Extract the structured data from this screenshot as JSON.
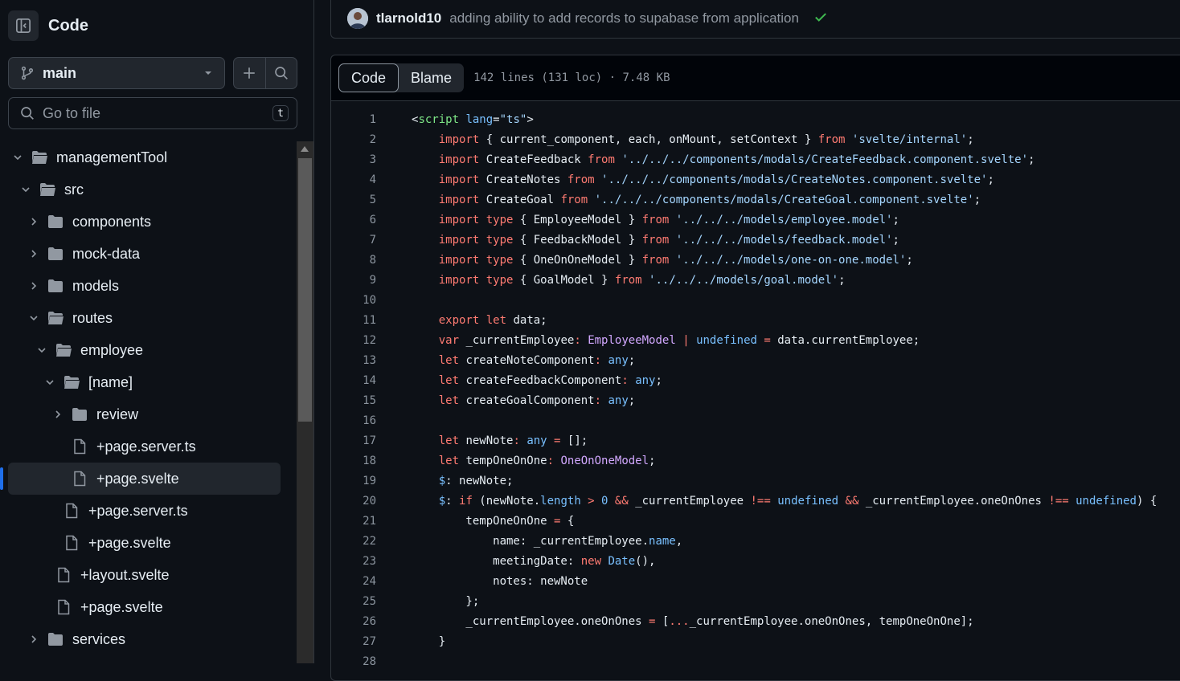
{
  "sidebar": {
    "title": "Code",
    "branch": "main",
    "search_placeholder": "Go to file",
    "search_shortcut": "t",
    "tree": [
      {
        "label": "managementTool",
        "type": "folder",
        "expanded": true,
        "depth": 0
      },
      {
        "label": "src",
        "type": "folder",
        "expanded": true,
        "depth": 1
      },
      {
        "label": "components",
        "type": "folder",
        "expanded": false,
        "depth": 2
      },
      {
        "label": "mock-data",
        "type": "folder",
        "expanded": false,
        "depth": 2
      },
      {
        "label": "models",
        "type": "folder",
        "expanded": false,
        "depth": 2
      },
      {
        "label": "routes",
        "type": "folder",
        "expanded": true,
        "depth": 2
      },
      {
        "label": "employee",
        "type": "folder",
        "expanded": true,
        "depth": 3
      },
      {
        "label": "[name]",
        "type": "folder",
        "expanded": true,
        "depth": 4
      },
      {
        "label": "review",
        "type": "folder",
        "expanded": false,
        "depth": 5
      },
      {
        "label": "+page.server.ts",
        "type": "file",
        "depth": 5
      },
      {
        "label": "+page.svelte",
        "type": "file",
        "depth": 5,
        "active": true
      },
      {
        "label": "+page.server.ts",
        "type": "file",
        "depth": 4
      },
      {
        "label": "+page.svelte",
        "type": "file",
        "depth": 4
      },
      {
        "label": "+layout.svelte",
        "type": "file",
        "depth": 3
      },
      {
        "label": "+page.svelte",
        "type": "file",
        "depth": 3
      },
      {
        "label": "services",
        "type": "folder",
        "expanded": false,
        "depth": 2
      }
    ]
  },
  "commit": {
    "user": "tlarnold10",
    "message": "adding ability to add records to supabase from application",
    "status": "success"
  },
  "code_view": {
    "tabs": [
      {
        "label": "Code",
        "active": true
      },
      {
        "label": "Blame",
        "active": false
      }
    ],
    "file_info": "142 lines (131 loc) · 7.48 KB",
    "lines": [
      [
        [
          "<",
          "id"
        ],
        [
          "script",
          "tag"
        ],
        [
          " lang",
          "c"
        ],
        [
          "=",
          "id"
        ],
        [
          "\"ts\"",
          "str"
        ],
        [
          ">",
          "id"
        ]
      ],
      [
        [
          "    import",
          "kw"
        ],
        [
          " { current_component, each, onMount, setContext } ",
          "id"
        ],
        [
          "from",
          "kw"
        ],
        [
          " ",
          "id"
        ],
        [
          "'svelte/internal'",
          "str"
        ],
        [
          ";",
          "id"
        ]
      ],
      [
        [
          "    import",
          "kw"
        ],
        [
          " CreateFeedback ",
          "id"
        ],
        [
          "from",
          "kw"
        ],
        [
          " ",
          "id"
        ],
        [
          "'../../../components/modals/CreateFeedback.component.svelte'",
          "str"
        ],
        [
          ";",
          "id"
        ]
      ],
      [
        [
          "    import",
          "kw"
        ],
        [
          " CreateNotes ",
          "id"
        ],
        [
          "from",
          "kw"
        ],
        [
          " ",
          "id"
        ],
        [
          "'../../../components/modals/CreateNotes.component.svelte'",
          "str"
        ],
        [
          ";",
          "id"
        ]
      ],
      [
        [
          "    import",
          "kw"
        ],
        [
          " CreateGoal ",
          "id"
        ],
        [
          "from",
          "kw"
        ],
        [
          " ",
          "id"
        ],
        [
          "'../../../components/modals/CreateGoal.component.svelte'",
          "str"
        ],
        [
          ";",
          "id"
        ]
      ],
      [
        [
          "    import",
          "kw"
        ],
        [
          " ",
          "id"
        ],
        [
          "type",
          "kw"
        ],
        [
          " { EmployeeModel } ",
          "id"
        ],
        [
          "from",
          "kw"
        ],
        [
          " ",
          "id"
        ],
        [
          "'../../../models/employee.model'",
          "str"
        ],
        [
          ";",
          "id"
        ]
      ],
      [
        [
          "    import",
          "kw"
        ],
        [
          " ",
          "id"
        ],
        [
          "type",
          "kw"
        ],
        [
          " { FeedbackModel } ",
          "id"
        ],
        [
          "from",
          "kw"
        ],
        [
          " ",
          "id"
        ],
        [
          "'../../../models/feedback.model'",
          "str"
        ],
        [
          ";",
          "id"
        ]
      ],
      [
        [
          "    import",
          "kw"
        ],
        [
          " ",
          "id"
        ],
        [
          "type",
          "kw"
        ],
        [
          " { OneOnOneModel } ",
          "id"
        ],
        [
          "from",
          "kw"
        ],
        [
          " ",
          "id"
        ],
        [
          "'../../../models/one-on-one.model'",
          "str"
        ],
        [
          ";",
          "id"
        ]
      ],
      [
        [
          "    import",
          "kw"
        ],
        [
          " ",
          "id"
        ],
        [
          "type",
          "kw"
        ],
        [
          " { GoalModel } ",
          "id"
        ],
        [
          "from",
          "kw"
        ],
        [
          " ",
          "id"
        ],
        [
          "'../../../models/goal.model'",
          "str"
        ],
        [
          ";",
          "id"
        ]
      ],
      [],
      [
        [
          "    export",
          "kw"
        ],
        [
          " ",
          "id"
        ],
        [
          "let",
          "kw"
        ],
        [
          " data;",
          "id"
        ]
      ],
      [
        [
          "    var",
          "kw"
        ],
        [
          " _currentEmployee",
          "id"
        ],
        [
          ":",
          "kw"
        ],
        [
          " ",
          "id"
        ],
        [
          "EmployeeModel",
          "fn"
        ],
        [
          " | ",
          "kw"
        ],
        [
          "undefined",
          "c"
        ],
        [
          " = ",
          "kw"
        ],
        [
          "data.currentEmployee;",
          "id"
        ]
      ],
      [
        [
          "    let",
          "kw"
        ],
        [
          " createNoteComponent",
          "id"
        ],
        [
          ":",
          "kw"
        ],
        [
          " ",
          "id"
        ],
        [
          "any",
          "c"
        ],
        [
          ";",
          "id"
        ]
      ],
      [
        [
          "    let",
          "kw"
        ],
        [
          " createFeedbackComponent",
          "id"
        ],
        [
          ":",
          "kw"
        ],
        [
          " ",
          "id"
        ],
        [
          "any",
          "c"
        ],
        [
          ";",
          "id"
        ]
      ],
      [
        [
          "    let",
          "kw"
        ],
        [
          " createGoalComponent",
          "id"
        ],
        [
          ":",
          "kw"
        ],
        [
          " ",
          "id"
        ],
        [
          "any",
          "c"
        ],
        [
          ";",
          "id"
        ]
      ],
      [],
      [
        [
          "    let",
          "kw"
        ],
        [
          " newNote",
          "id"
        ],
        [
          ":",
          "kw"
        ],
        [
          " ",
          "id"
        ],
        [
          "any",
          "c"
        ],
        [
          " = ",
          "kw"
        ],
        [
          "[];",
          "id"
        ]
      ],
      [
        [
          "    let",
          "kw"
        ],
        [
          " tempOneOnOne",
          "id"
        ],
        [
          ":",
          "kw"
        ],
        [
          " ",
          "id"
        ],
        [
          "OneOnOneModel",
          "fn"
        ],
        [
          ";",
          "id"
        ]
      ],
      [
        [
          "    $",
          "c"
        ],
        [
          ": newNote;",
          "id"
        ]
      ],
      [
        [
          "    $",
          "c"
        ],
        [
          ": ",
          "id"
        ],
        [
          "if",
          "kw"
        ],
        [
          " (newNote.",
          "id"
        ],
        [
          "length",
          "c"
        ],
        [
          " > ",
          "kw"
        ],
        [
          "0",
          "c"
        ],
        [
          " && ",
          "kw"
        ],
        [
          "_currentEmployee ",
          "id"
        ],
        [
          "!==",
          "kw"
        ],
        [
          " ",
          "id"
        ],
        [
          "undefined",
          "c"
        ],
        [
          " && ",
          "kw"
        ],
        [
          "_currentEmployee.oneOnOnes ",
          "id"
        ],
        [
          "!==",
          "kw"
        ],
        [
          " ",
          "id"
        ],
        [
          "undefined",
          "c"
        ],
        [
          ") {",
          "id"
        ]
      ],
      [
        [
          "        tempOneOnOne ",
          "id"
        ],
        [
          "=",
          "kw"
        ],
        [
          " {",
          "id"
        ]
      ],
      [
        [
          "            name: _currentEmployee.",
          "id"
        ],
        [
          "name",
          "c"
        ],
        [
          ",",
          "id"
        ]
      ],
      [
        [
          "            meetingDate: ",
          "id"
        ],
        [
          "new",
          "kw"
        ],
        [
          " ",
          "id"
        ],
        [
          "Date",
          "c"
        ],
        [
          "(),",
          "id"
        ]
      ],
      [
        [
          "            notes: newNote",
          "id"
        ]
      ],
      [
        [
          "        };",
          "id"
        ]
      ],
      [
        [
          "        _currentEmployee.oneOnOnes ",
          "id"
        ],
        [
          "=",
          "kw"
        ],
        [
          " [",
          "id"
        ],
        [
          "...",
          "kw"
        ],
        [
          "_currentEmployee.oneOnOnes, tempOneOnOne];",
          "id"
        ]
      ],
      [
        [
          "    }",
          "id"
        ]
      ],
      []
    ]
  },
  "colors": {
    "bg": "#0d1117",
    "keyword": "#ff7b72",
    "string": "#a5d6ff",
    "type": "#d2a8ff",
    "constant": "#79c0ff",
    "tag": "#7ee787",
    "accent": "#1f6feb",
    "success": "#3fb950"
  }
}
